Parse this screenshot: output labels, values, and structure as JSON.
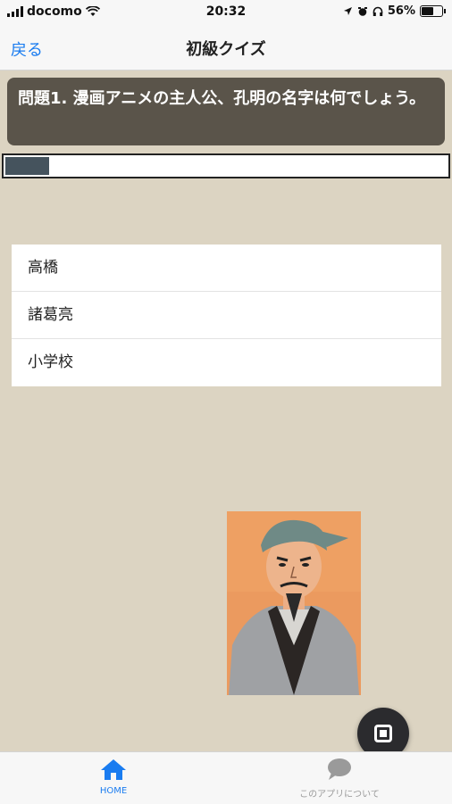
{
  "status_bar": {
    "carrier": "docomo",
    "time": "20:32",
    "battery": "56%"
  },
  "nav": {
    "back_label": "戻る",
    "title": "初級クイズ"
  },
  "question": {
    "text": "問題1. 漫画アニメの主人公、孔明の名字は何でしょう。"
  },
  "progress": {
    "fraction": 0.1
  },
  "options": [
    {
      "label": "高橋"
    },
    {
      "label": "諸葛亮"
    },
    {
      "label": "小学校"
    }
  ],
  "tabs": [
    {
      "label": "HOME",
      "icon": "home-icon"
    },
    {
      "label": "このアプリについて",
      "icon": "speech-bubble-icon"
    }
  ],
  "colors": {
    "accent": "#1a7cf0",
    "background": "#dcd4c2",
    "question_bg": "#5a544a"
  }
}
